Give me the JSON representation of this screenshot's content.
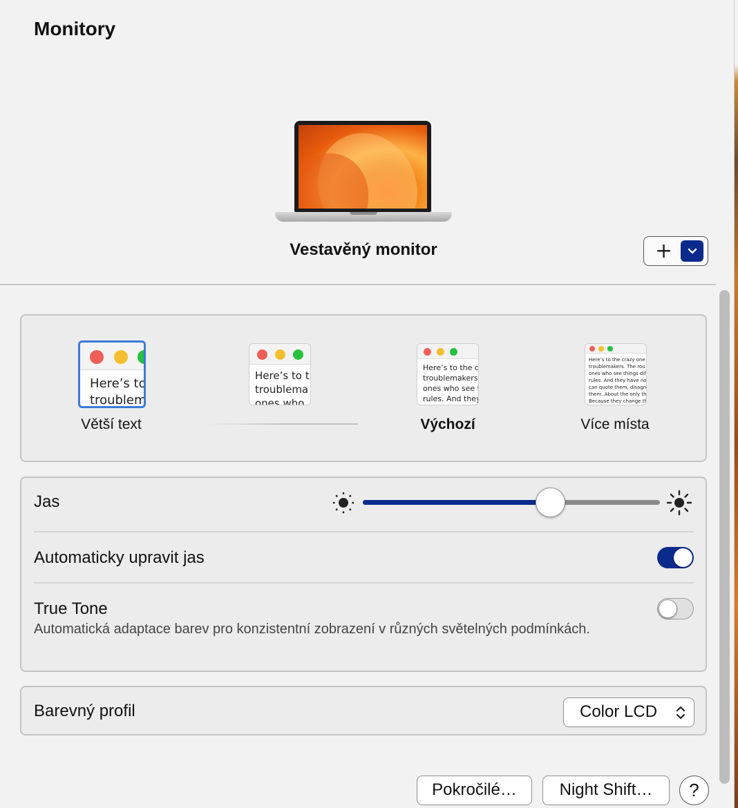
{
  "window": {
    "title": "Monitory"
  },
  "display": {
    "name": "Vestavěný monitor",
    "add_label": "+"
  },
  "resolution": {
    "options": [
      {
        "label": "Větší text",
        "sample": "Here’s to\ntroublem",
        "selected": true
      },
      {
        "label": "",
        "sample": "Here’s to t\ntroublema\nones who",
        "selected": false
      },
      {
        "label": "Výchozí",
        "sample": "Here’s to the cr\ntroublemakers.\nones who see t\nrules. And they",
        "selected": false
      },
      {
        "label": "Více místa",
        "sample": "Here’s to the crazy one\ntroublemakers. The rou\nones who see things dif\nrules. And they have no\ncan quote them, disagre\nthem. About the only th\nBecause they change th",
        "selected": false
      }
    ]
  },
  "settings": {
    "brightness": {
      "label": "Jas",
      "value": 0.63
    },
    "auto_brightness": {
      "label": "Automaticky upravit jas",
      "enabled": true
    },
    "true_tone": {
      "label": "True Tone",
      "description": "Automatická adaptace barev pro konzistentní zobrazení v různých světelných podmínkách.",
      "enabled": false
    }
  },
  "color_profile": {
    "label": "Barevný profil",
    "value": "Color LCD"
  },
  "footer": {
    "advanced_button": "Pokročilé…",
    "night_shift_button": "Night Shift…",
    "help_button": "?"
  },
  "colors": {
    "accent": "#0a2a8c",
    "selection": "#3b7bd6"
  },
  "icons": [
    "plus-icon",
    "chevron-down-icon",
    "sun-small-icon",
    "sun-large-icon",
    "up-down-arrows-icon",
    "question-icon"
  ]
}
